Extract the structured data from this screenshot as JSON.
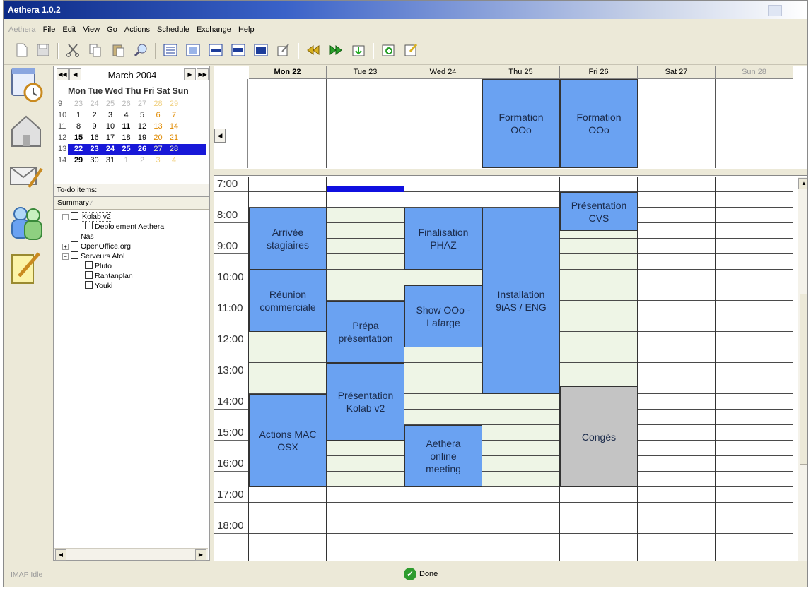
{
  "window": {
    "title": "Aethera 1.0.2"
  },
  "menu": [
    "Aethera",
    "File",
    "Edit",
    "View",
    "Go",
    "Actions",
    "Schedule",
    "Exchange",
    "Help"
  ],
  "toolbar_icons": [
    "new-icon",
    "save-icon",
    "cut-icon",
    "copy-icon",
    "paste-icon",
    "find-icon",
    "list-view-icon",
    "day-view-icon",
    "workweek-view-icon",
    "week-view-icon",
    "month-view-icon",
    "edit-icon",
    "previous-icon",
    "next-icon",
    "today-icon",
    "add-appointment-icon",
    "add-task-icon"
  ],
  "sidebar_icons": [
    "calendar-icon",
    "home-icon",
    "mail-icon",
    "contacts-icon",
    "notes-icon"
  ],
  "minical": {
    "month": "March 2004",
    "dow": "Mon Tue Wed Thu Fri Sat Sun",
    "weeks": [
      {
        "wk": "9",
        "days": [
          "23",
          "24",
          "25",
          "26",
          "27",
          "28",
          "29"
        ]
      },
      {
        "wk": "10",
        "days": [
          "1",
          "2",
          "3",
          "4",
          "5",
          "6",
          "7"
        ]
      },
      {
        "wk": "11",
        "days": [
          "8",
          "9",
          "10",
          "11",
          "12",
          "13",
          "14"
        ]
      },
      {
        "wk": "12",
        "days": [
          "15",
          "16",
          "17",
          "18",
          "19",
          "20",
          "21"
        ]
      },
      {
        "wk": "13",
        "days": [
          "22",
          "23",
          "24",
          "25",
          "26",
          "27",
          "28"
        ]
      },
      {
        "wk": "14",
        "days": [
          "29",
          "30",
          "31",
          "1",
          "2",
          "3",
          "4"
        ]
      }
    ]
  },
  "todo": {
    "header": "To-do items:",
    "column": "Summary",
    "items": [
      "Kolab v2",
      "Deploiement Aethera",
      "Nas",
      "OpenOffice.org",
      "Serveurs Atol",
      "Pluto",
      "Rantanplan",
      "Youki"
    ]
  },
  "week": {
    "days": [
      "Mon 22",
      "Tue 23",
      "Wed 24",
      "Thu 25",
      "Fri 26",
      "Sat 27",
      "Sun 28"
    ],
    "times": [
      "7:00",
      "8:00",
      "9:00",
      "10:00",
      "11:00",
      "12:00",
      "13:00",
      "14:00",
      "15:00",
      "16:00",
      "17:00",
      "18:00"
    ],
    "allday": [
      {
        "day": 3,
        "label": "Formation\nOOo"
      },
      {
        "day": 4,
        "label": "Formation\nOOo"
      }
    ],
    "events": [
      {
        "day": 0,
        "start": 8.0,
        "end": 10.0,
        "label": "Arrivée\nstagiaires",
        "color": "blue"
      },
      {
        "day": 0,
        "start": 10.0,
        "end": 12.0,
        "label": "Réunion\ncommerciale",
        "color": "blue"
      },
      {
        "day": 0,
        "start": 14.0,
        "end": 17.0,
        "label": "Actions MAC\nOSX",
        "color": "blue"
      },
      {
        "day": 1,
        "start": 11.0,
        "end": 13.0,
        "label": "Prépa\nprésentation",
        "color": "blue"
      },
      {
        "day": 1,
        "start": 13.0,
        "end": 15.5,
        "label": "Présentation\nKolab v2",
        "color": "blue"
      },
      {
        "day": 2,
        "start": 8.0,
        "end": 10.0,
        "label": "Finalisation\nPHAZ",
        "color": "blue"
      },
      {
        "day": 2,
        "start": 10.5,
        "end": 12.5,
        "label": "Show OOo -\nLafarge",
        "color": "blue"
      },
      {
        "day": 2,
        "start": 15.0,
        "end": 17.0,
        "label": "Aethera\nonline\nmeeting",
        "color": "blue"
      },
      {
        "day": 3,
        "start": 8.0,
        "end": 14.0,
        "label": "Installation\n9iAS / ENG",
        "color": "blue"
      },
      {
        "day": 4,
        "start": 7.5,
        "end": 8.75,
        "label": "Présentation\nCVS",
        "color": "blue"
      },
      {
        "day": 4,
        "start": 13.75,
        "end": 17.0,
        "label": "Congés",
        "color": "grey"
      }
    ],
    "selected_bar": {
      "day": 1,
      "start": 7.25,
      "end": 7.5
    }
  },
  "status": {
    "left": "IMAP Idle",
    "center": "Done"
  },
  "colors": {
    "event_blue": "#6aa2f2",
    "event_grey": "#c4c4c4",
    "work_hours": "#eef5e6",
    "sel_blue": "#1010e0"
  }
}
